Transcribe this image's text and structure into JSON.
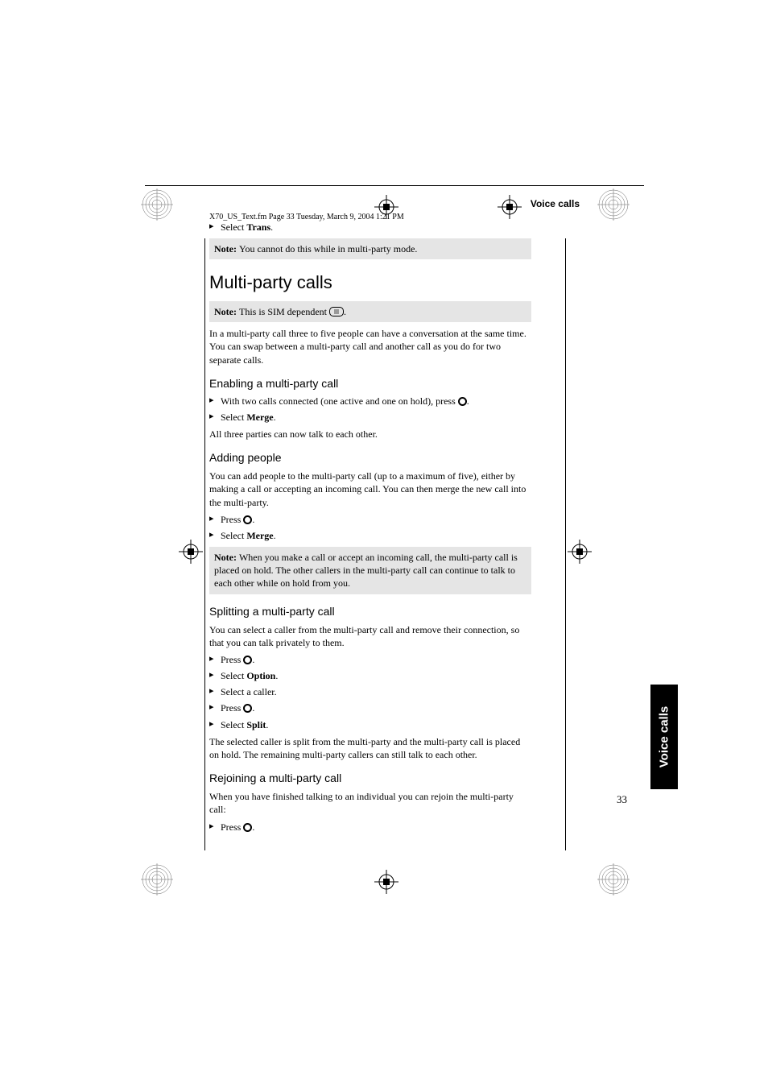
{
  "header": {
    "footer_stamp": "X70_US_Text.fm  Page 33  Tuesday, March 9, 2004  1:21 PM",
    "section_title": "Voice calls"
  },
  "page_number": "33",
  "side_tab": "Voice calls",
  "content": {
    "sel_trans_pre": "Select ",
    "sel_trans_bold": "Trans",
    "note1": "You cannot do this while in multi-party mode.",
    "h1": "Multi-party calls",
    "note2": "This is SIM dependent",
    "p1": "In a multi-party call three to five people can have a conversation at the same time. You can swap between a multi-party call and another call as you do for two separate calls.",
    "h2_enable": "Enabling a multi-party call",
    "enable_b1": "With two calls connected (one active and one on hold), press ",
    "enable_b2_pre": "Select ",
    "enable_b2_bold": "Merge",
    "enable_p": "All three parties can now talk to each other.",
    "h2_adding": "Adding people",
    "adding_p1": "You can add people to the multi-party call (up to a maximum of five), either by making a call or accepting an incoming call. You can then merge the new call into the multi-party.",
    "adding_b1": "Press ",
    "adding_b2_pre": "Select ",
    "adding_b2_bold": "Merge",
    "note3": "When you make a call or accept an incoming call, the multi-party call is placed on hold. The other callers in the multi-party call can continue to talk to each other while on hold from you.",
    "h2_split": "Splitting a multi-party call",
    "split_p1": "You can select a caller from the multi-party call and remove their connection, so that you can talk privately to them.",
    "split_b1": "Press ",
    "split_b2_pre": "Select ",
    "split_b2_bold": "Option",
    "split_b3": "Select a caller.",
    "split_b4": "Press ",
    "split_b5_pre": "Select ",
    "split_b5_bold": "Split",
    "split_p2": "The selected caller is split from the multi-party and the multi-party call is placed on hold. The remaining multi-party callers can still talk to each other.",
    "h2_rejoin": "Rejoining a multi-party call",
    "rejoin_p1": "When you have finished talking to an individual you can rejoin the multi-party call:",
    "rejoin_b1": "Press ",
    "note_label": "Note: "
  }
}
